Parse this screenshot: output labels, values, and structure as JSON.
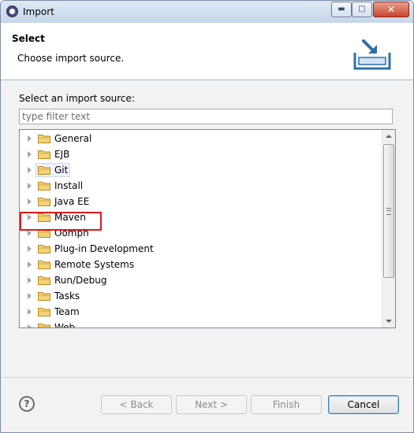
{
  "window": {
    "title": "Import",
    "min_glyph": "▬",
    "max_glyph": "□",
    "close_glyph": "✕"
  },
  "header": {
    "title": "Select",
    "description": "Choose import source."
  },
  "main": {
    "source_label": "Select an import source:",
    "filter_placeholder": "type filter text",
    "tree_items": [
      {
        "label": "General",
        "highlighted": false
      },
      {
        "label": "EJB",
        "highlighted": false
      },
      {
        "label": "Git",
        "highlighted": true
      },
      {
        "label": "Install",
        "highlighted": false
      },
      {
        "label": "Java EE",
        "highlighted": false
      },
      {
        "label": "Maven",
        "highlighted": false
      },
      {
        "label": "Oomph",
        "highlighted": false
      },
      {
        "label": "Plug-in Development",
        "highlighted": false
      },
      {
        "label": "Remote Systems",
        "highlighted": false
      },
      {
        "label": "Run/Debug",
        "highlighted": false
      },
      {
        "label": "Tasks",
        "highlighted": false
      },
      {
        "label": "Team",
        "highlighted": false
      },
      {
        "label": "Web",
        "highlighted": false
      }
    ]
  },
  "footer": {
    "help_glyph": "?",
    "back_label": "< Back",
    "next_label": "Next >",
    "finish_label": "Finish",
    "cancel_label": "Cancel"
  },
  "colors": {
    "highlight_box": "#e01919",
    "folder": "#e8c46a"
  },
  "icons": [
    "eclipse-app-icon",
    "import-banner-icon",
    "folder-icon",
    "expand-arrow-icon",
    "help-icon"
  ]
}
